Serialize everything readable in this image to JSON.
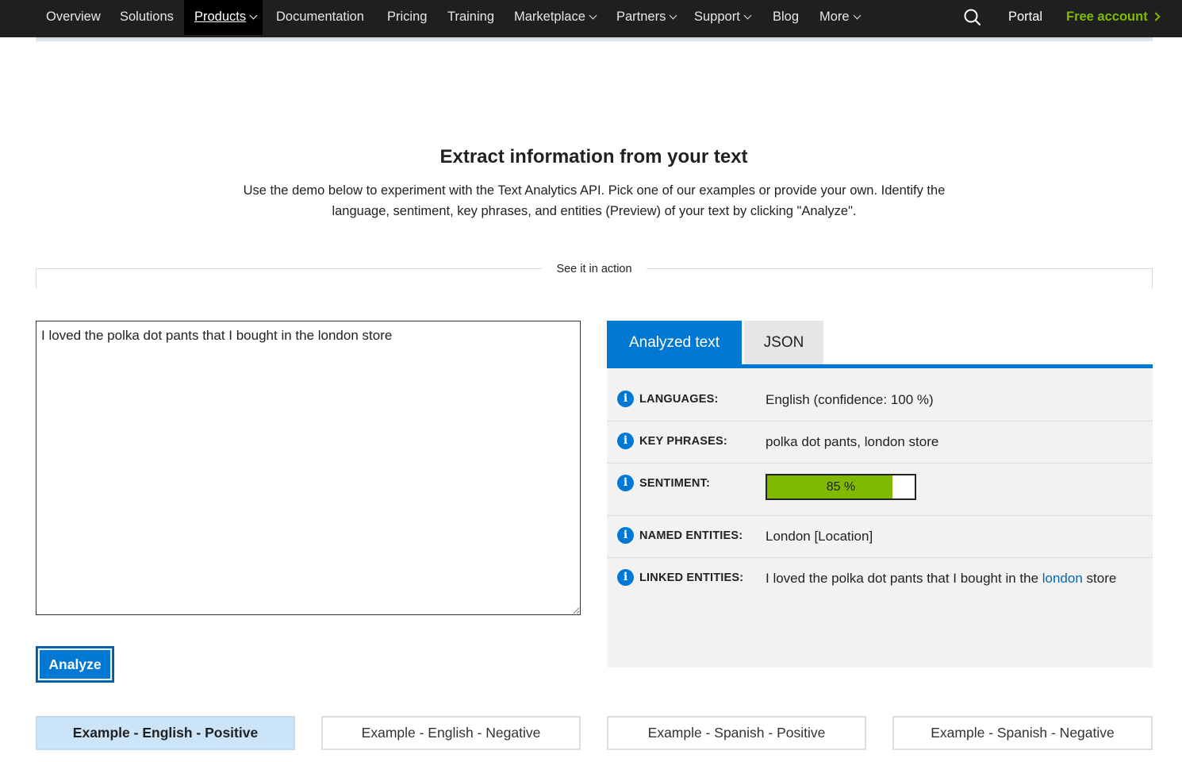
{
  "nav": {
    "items": [
      {
        "label": "Overview",
        "dropdown": false
      },
      {
        "label": "Solutions",
        "dropdown": false
      },
      {
        "label": "Products",
        "dropdown": true,
        "active": true
      },
      {
        "label": "Documentation",
        "dropdown": false
      },
      {
        "label": "Pricing",
        "dropdown": false
      },
      {
        "label": "Training",
        "dropdown": false
      },
      {
        "label": "Marketplace",
        "dropdown": true
      },
      {
        "label": "Partners",
        "dropdown": true
      },
      {
        "label": "Support",
        "dropdown": true
      },
      {
        "label": "Blog",
        "dropdown": false
      },
      {
        "label": "More",
        "dropdown": true
      }
    ],
    "portal": "Portal",
    "free_account": "Free account",
    "search_icon": "search-icon",
    "accent_color": "#7fba00"
  },
  "hero": {
    "title": "Extract information from your text",
    "description": "Use the demo below to experiment with the Text Analytics API. Pick one of our examples or provide your own. Identify the language, sentiment, key phrases, and entities (Preview) of your text by clicking \"Analyze\"."
  },
  "demo": {
    "section_label": "See it in action",
    "input_text": "I loved the polka dot pants that I bought in the london store",
    "analyze_label": "Analyze",
    "tabs": {
      "analyzed": "Analyzed text",
      "json": "JSON"
    },
    "results": {
      "languages": {
        "label": "LANGUAGES:",
        "value": "English (confidence: 100 %)"
      },
      "key_phrases": {
        "label": "KEY PHRASES:",
        "value": "polka dot pants, london store"
      },
      "sentiment": {
        "label": "SENTIMENT:",
        "text": "85 %",
        "score": 0.85
      },
      "named_entities": {
        "label": "NAMED ENTITIES:",
        "value": "London [Location]"
      },
      "linked_entities": {
        "label": "LINKED ENTITIES:",
        "before": "I loved the polka dot pants that I bought in the ",
        "link": "london",
        "after": " store"
      }
    },
    "info_icon": "info-icon",
    "primary_color": "#0078d4"
  },
  "examples": [
    {
      "label": "Example - English - Positive",
      "selected": true
    },
    {
      "label": "Example - English - Negative",
      "selected": false
    },
    {
      "label": "Example - Spanish - Positive",
      "selected": false
    },
    {
      "label": "Example - Spanish - Negative",
      "selected": false
    }
  ]
}
